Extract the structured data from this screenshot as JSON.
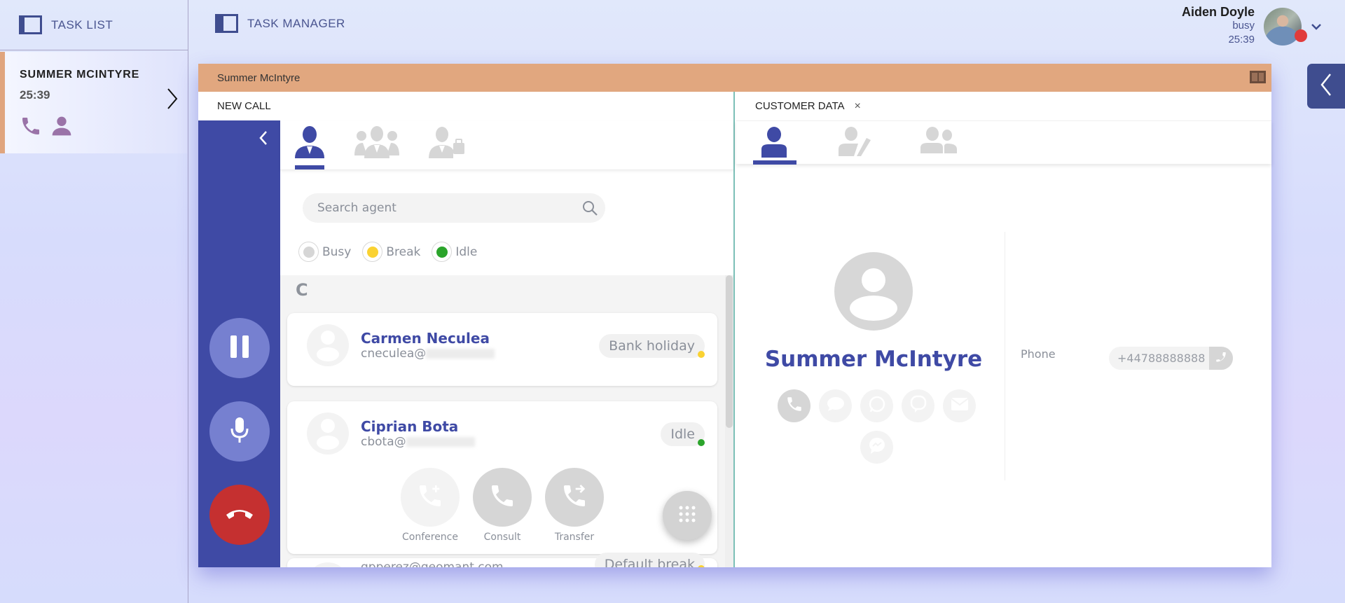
{
  "task_list": {
    "header_label": "TASK LIST",
    "tasks": [
      {
        "name": "SUMMER MCINTYRE",
        "time": "25:39",
        "icons": [
          "phone-icon",
          "person-icon"
        ]
      }
    ]
  },
  "task_manager": {
    "header_label": "TASK MANAGER"
  },
  "user": {
    "name": "Aiden Doyle",
    "status": "busy",
    "time": "25:39",
    "status_color": "#e13b3b"
  },
  "window": {
    "title": "Summer McIntyre",
    "accent_color": "#e1a77f"
  },
  "new_call": {
    "title": "NEW CALL",
    "tabs": [
      {
        "name": "agents",
        "icon": "agent-icon",
        "active": true
      },
      {
        "name": "groups",
        "icon": "group-icon",
        "active": false
      },
      {
        "name": "external",
        "icon": "agent-briefcase-icon",
        "active": false
      }
    ],
    "search": {
      "placeholder": "Search agent",
      "value": ""
    },
    "filters": [
      {
        "label": "Busy",
        "color": "#d6d6d6"
      },
      {
        "label": "Break",
        "color": "#fad232"
      },
      {
        "label": "Idle",
        "color": "#2ba42b"
      }
    ],
    "section_letter": "C",
    "agents": [
      {
        "name": "Carmen Neculea",
        "email_prefix": "cneculea@",
        "status": "Bank holiday",
        "status_color": "#fad232"
      },
      {
        "name": "Ciprian Bota",
        "email_prefix": "cbota@",
        "status": "Idle",
        "status_color": "#2ba42b"
      },
      {
        "name": "",
        "email_prefix": "gpperez@geomant.com",
        "status": "Default break",
        "status_color": "#fad232"
      }
    ],
    "actions": [
      {
        "label": "Conference",
        "icon": "phone-plus-icon",
        "enabled": false
      },
      {
        "label": "Consult",
        "icon": "phone-icon",
        "enabled": true
      },
      {
        "label": "Transfer",
        "icon": "phone-forward-icon",
        "enabled": true
      }
    ],
    "call_controls": [
      {
        "name": "hold",
        "icon": "pause-icon"
      },
      {
        "name": "mute",
        "icon": "microphone-icon"
      },
      {
        "name": "hangup",
        "icon": "hang-up-icon",
        "color": "#c53030"
      }
    ]
  },
  "customer_data": {
    "title": "CUSTOMER DATA",
    "close_label": "×",
    "tabs": [
      {
        "name": "profile",
        "icon": "person-icon",
        "active": true
      },
      {
        "name": "edit",
        "icon": "person-edit-icon",
        "active": false
      },
      {
        "name": "contacts",
        "icon": "people-icon",
        "active": false
      }
    ],
    "customer_name": "Summer McIntyre",
    "channels": [
      {
        "name": "phone",
        "icon": "phone-icon",
        "active": true
      },
      {
        "name": "chat",
        "icon": "chat-icon",
        "active": false
      },
      {
        "name": "whatsapp",
        "icon": "whatsapp-icon",
        "active": false
      },
      {
        "name": "viber",
        "icon": "viber-icon",
        "active": false
      },
      {
        "name": "email",
        "icon": "email-icon",
        "active": false
      },
      {
        "name": "messenger",
        "icon": "messenger-icon",
        "active": false
      }
    ],
    "fields": [
      {
        "label": "Phone",
        "value": "+44788888888"
      }
    ]
  }
}
